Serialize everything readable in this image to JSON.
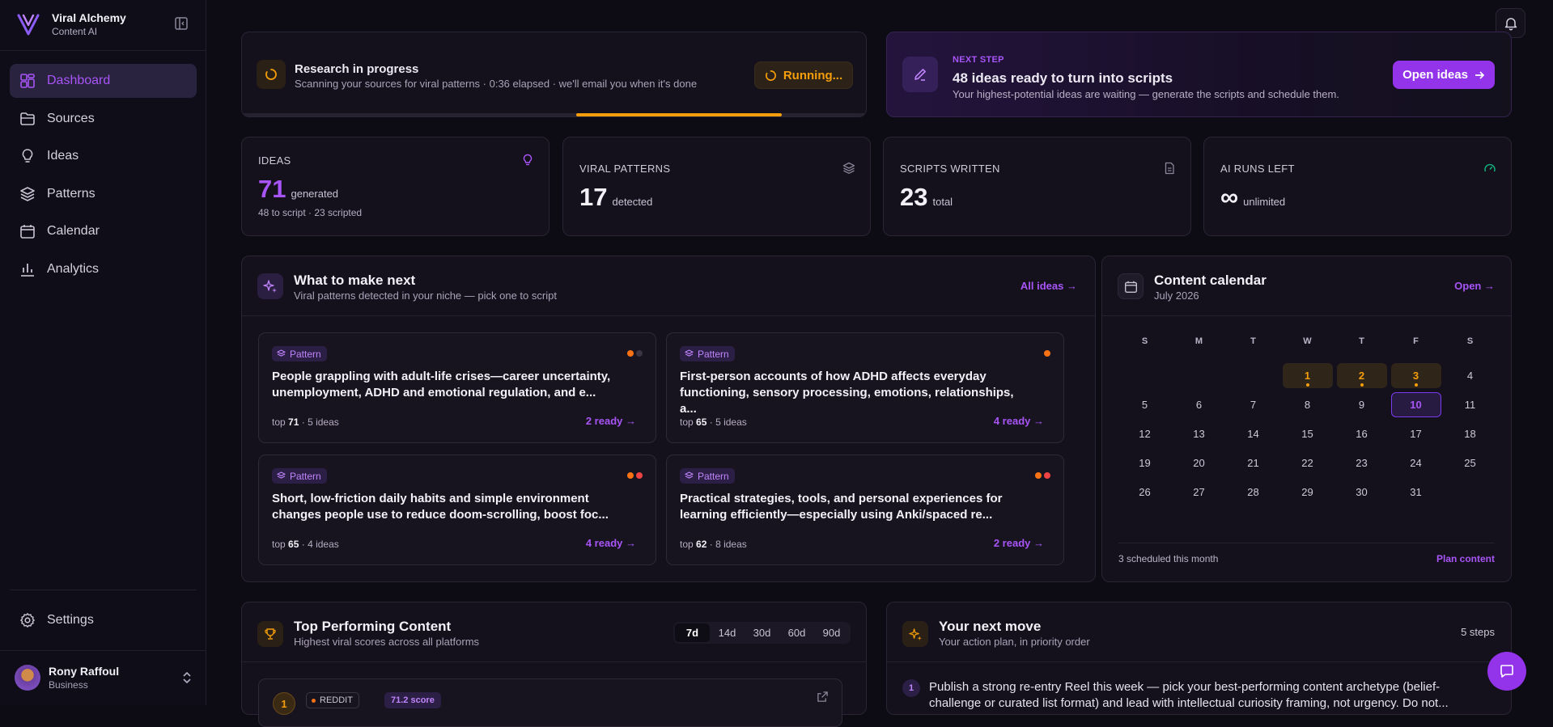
{
  "brand": {
    "name": "Viral Alchemy",
    "tagline": "Content AI"
  },
  "nav": [
    {
      "label": "Dashboard",
      "icon": "dashboard-icon",
      "active": true
    },
    {
      "label": "Sources",
      "icon": "folder-icon"
    },
    {
      "label": "Ideas",
      "icon": "lightbulb-icon"
    },
    {
      "label": "Patterns",
      "icon": "layers-icon"
    },
    {
      "label": "Calendar",
      "icon": "calendar-icon"
    },
    {
      "label": "Analytics",
      "icon": "bar-chart-icon"
    }
  ],
  "settings_label": "Settings",
  "user": {
    "name": "Rony Raffoul",
    "plan": "Business"
  },
  "research": {
    "title": "Research in progress",
    "subtitle": "Scanning your sources for viral patterns · 0:36 elapsed · we'll email you when it's done",
    "status": "Running...",
    "progress": 0.33
  },
  "next_step": {
    "kicker": "NEXT STEP",
    "title": "48 ideas ready to turn into scripts",
    "subtitle": "Your highest-potential ideas are waiting — generate the scripts and schedule them.",
    "button": "Open ideas"
  },
  "stats": [
    {
      "label": "IDEAS",
      "value": "71",
      "unit": "generated",
      "sub": "48 to script · 23 scripted",
      "icon": "lightbulb-icon"
    },
    {
      "label": "VIRAL PATTERNS",
      "value": "17",
      "unit": "detected",
      "icon": "layers-icon"
    },
    {
      "label": "SCRIPTS WRITTEN",
      "value": "23",
      "unit": "total",
      "icon": "document-icon"
    },
    {
      "label": "AI RUNS LEFT",
      "value": "∞",
      "unit": "unlimited",
      "icon": "gauge-icon"
    }
  ],
  "what_next": {
    "title": "What to make next",
    "subtitle": "Viral patterns detected in your niche — pick one to script",
    "link": "All ideas",
    "cards": [
      {
        "badge": "Pattern",
        "title": "People grappling with adult-life crises—career uncertainty, unemployment, ADHD and emotional regulation, and e...",
        "top_label": "top",
        "top": "71",
        "ideas": "· 5 ideas",
        "ready": "2 ready",
        "dots": [
          "#f97316",
          "#3a3444"
        ]
      },
      {
        "badge": "Pattern",
        "title": "First-person accounts of how ADHD affects everyday functioning, sensory processing, emotions, relationships, a...",
        "top_label": "top",
        "top": "65",
        "ideas": "· 5 ideas",
        "ready": "4 ready",
        "dots": [
          "#f97316"
        ]
      },
      {
        "badge": "Pattern",
        "title": "Short, low-friction daily habits and simple environment changes people use to reduce doom-scrolling, boost foc...",
        "top_label": "top",
        "top": "65",
        "ideas": "· 4 ideas",
        "ready": "4 ready",
        "dots": [
          "#f97316",
          "#ef4444"
        ]
      },
      {
        "badge": "Pattern",
        "title": "Practical strategies, tools, and personal experiences for learning efficiently—especially using Anki/spaced re...",
        "top_label": "top",
        "top": "62",
        "ideas": "· 8 ideas",
        "ready": "2 ready",
        "dots": [
          "#f97316",
          "#ef4444"
        ]
      }
    ]
  },
  "calendar": {
    "title": "Content calendar",
    "month": "July 2026",
    "link": "Open",
    "weekdays": [
      "S",
      "M",
      "T",
      "W",
      "T",
      "F",
      "S"
    ],
    "weeks": [
      [
        "",
        "",
        "",
        "1",
        "2",
        "3",
        "4"
      ],
      [
        "5",
        "6",
        "7",
        "8",
        "9",
        "10",
        "11"
      ],
      [
        "12",
        "13",
        "14",
        "15",
        "16",
        "17",
        "18"
      ],
      [
        "19",
        "20",
        "21",
        "22",
        "23",
        "24",
        "25"
      ],
      [
        "26",
        "27",
        "28",
        "29",
        "30",
        "31",
        ""
      ]
    ],
    "scheduled_days": [
      "1",
      "2",
      "3"
    ],
    "today": "10",
    "footer": "3 scheduled this month",
    "footer_link": "Plan content"
  },
  "top_content": {
    "title": "Top Performing Content",
    "subtitle": "Highest viral scores across all platforms",
    "ranges": [
      "7d",
      "14d",
      "30d",
      "60d",
      "90d"
    ],
    "active_range": "7d",
    "row": {
      "rank": "1",
      "platform": "REDDIT",
      "score": "71.2 score"
    }
  },
  "next_move": {
    "title": "Your next move",
    "subtitle": "Your action plan, in priority order",
    "steps": "5 steps",
    "step1_num": "1",
    "step1": "Publish a strong re-entry Reel this week — pick your best-performing content archetype (belief-challenge or curated list format) and lead with intellectual curiosity framing, not urgency. Do not..."
  },
  "colors": {
    "accent": "#a855f7",
    "warning": "#f59e0b",
    "bg": "#0d0b14"
  }
}
